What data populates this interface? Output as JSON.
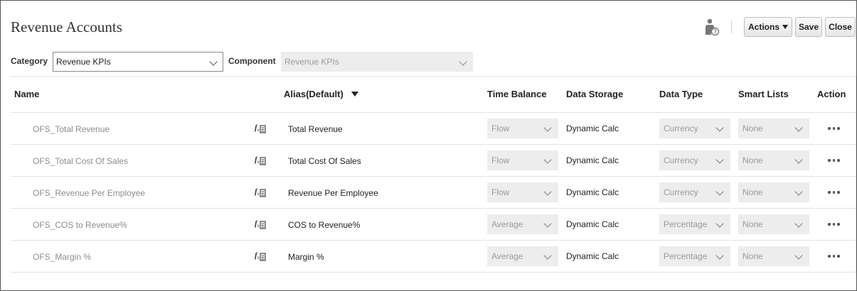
{
  "page": {
    "title": "Revenue Accounts"
  },
  "toolbar": {
    "help_icon": "user-help-icon",
    "actions_label": "Actions",
    "save_label": "Save",
    "close_label": "Close"
  },
  "filters": {
    "category_label": "Category",
    "category_value": "Revenue KPIs",
    "component_label": "Component",
    "component_value": "Revenue KPIs"
  },
  "table": {
    "columns": {
      "name": "Name",
      "alias": "Alias(Default)",
      "time_balance": "Time Balance",
      "data_storage": "Data Storage",
      "data_type": "Data Type",
      "smart_lists": "Smart Lists",
      "action": "Action"
    },
    "rows": [
      {
        "name": "OFS_Total Revenue",
        "alias": "Total Revenue",
        "time_balance": "Flow",
        "data_storage": "Dynamic Calc",
        "data_type": "Currency",
        "smart_lists": "None"
      },
      {
        "name": "OFS_Total Cost Of Sales",
        "alias": "Total Cost Of Sales",
        "time_balance": "Flow",
        "data_storage": "Dynamic Calc",
        "data_type": "Currency",
        "smart_lists": "None"
      },
      {
        "name": "OFS_Revenue Per Employee",
        "alias": "Revenue Per Employee",
        "time_balance": "Flow",
        "data_storage": "Dynamic Calc",
        "data_type": "Currency",
        "smart_lists": "None"
      },
      {
        "name": "OFS_COS to Revenue%",
        "alias": "COS to Revenue%",
        "time_balance": "Average",
        "data_storage": "Dynamic Calc",
        "data_type": "Percentage",
        "smart_lists": "None"
      },
      {
        "name": "OFS_Margin %",
        "alias": "Margin %",
        "time_balance": "Average",
        "data_storage": "Dynamic Calc",
        "data_type": "Percentage",
        "smart_lists": "None"
      }
    ]
  }
}
